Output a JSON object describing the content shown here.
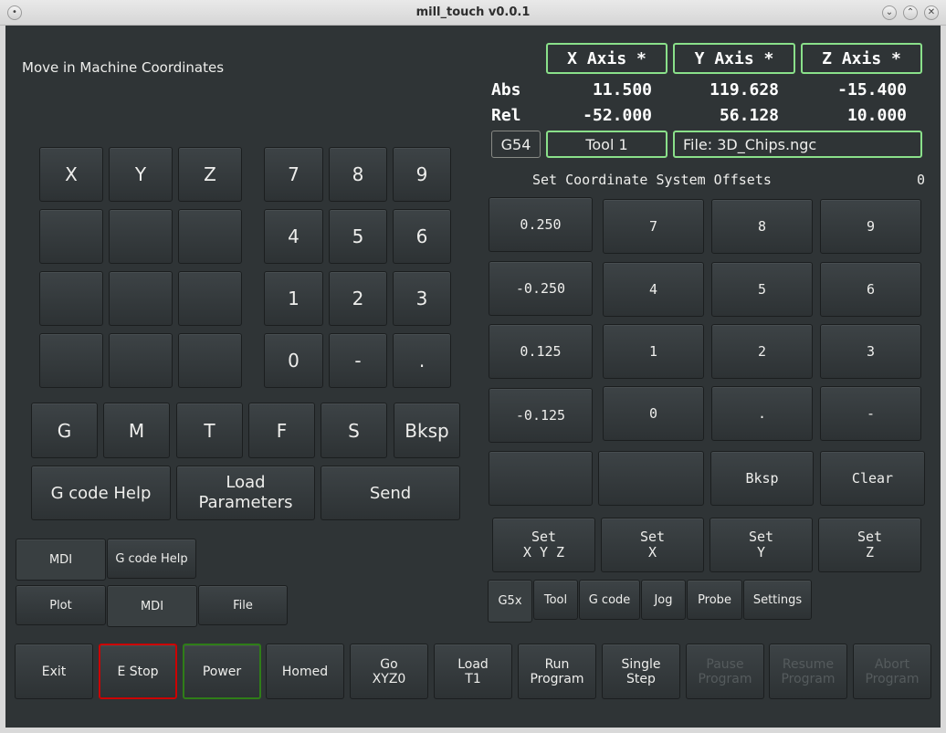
{
  "window": {
    "title": "mill_touch v0.0.1",
    "controls": [
      "minimize-icon",
      "maximize-icon",
      "close-icon"
    ]
  },
  "mode_label": "Move in Machine Coordinates",
  "axes": [
    "X Axis *",
    "Y Axis *",
    "Z Axis *"
  ],
  "dro": {
    "abs_label": "Abs",
    "rel_label": "Rel",
    "abs": [
      "11.500",
      "119.628",
      "-15.400"
    ],
    "rel": [
      "-52.000",
      "56.128",
      "10.000"
    ]
  },
  "status": {
    "coord_system": "G54",
    "tool": "Tool 1",
    "file": "File: 3D_Chips.ngc"
  },
  "offsets": {
    "title": "Set Coordinate System Offsets",
    "entry": "0",
    "jog_steps": [
      "0.250",
      "-0.250",
      "0.125",
      "-0.125"
    ],
    "keypad": [
      "7",
      "8",
      "9",
      "4",
      "5",
      "6",
      "1",
      "2",
      "3",
      "0",
      ".",
      "-"
    ],
    "bksp": "Bksp",
    "clear": "Clear",
    "set_buttons": [
      "Set\nX Y Z",
      "Set\nX",
      "Set\nY",
      "Set\nZ"
    ]
  },
  "mdi_keypad": {
    "axis_keys": [
      "X",
      "Y",
      "Z"
    ],
    "digits": [
      "7",
      "8",
      "9",
      "4",
      "5",
      "6",
      "1",
      "2",
      "3",
      "0",
      "-",
      "."
    ],
    "word_keys": [
      "G",
      "M",
      "T",
      "F",
      "S",
      "Bksp"
    ],
    "actions": [
      "G code Help",
      "Load\nParameters",
      "Send"
    ]
  },
  "left_tabs_top": [
    "MDI",
    "G code Help"
  ],
  "left_tabs_bottom": [
    "Plot",
    "MDI",
    "File"
  ],
  "right_tabs": [
    "G5x",
    "Tool",
    "G code",
    "Jog",
    "Probe",
    "Settings"
  ],
  "bottom_bar": [
    "Exit",
    "E Stop",
    "Power",
    "Homed",
    "Go\nXYZ0",
    "Load\nT1",
    "Run\nProgram",
    "Single\nStep",
    "Pause\nProgram",
    "Resume\nProgram",
    "Abort\nProgram"
  ],
  "colors": {
    "background": "#2f3436",
    "axis_border": "#8ae08a",
    "estop_border": "#cc0000",
    "power_border": "#2f7d18"
  }
}
